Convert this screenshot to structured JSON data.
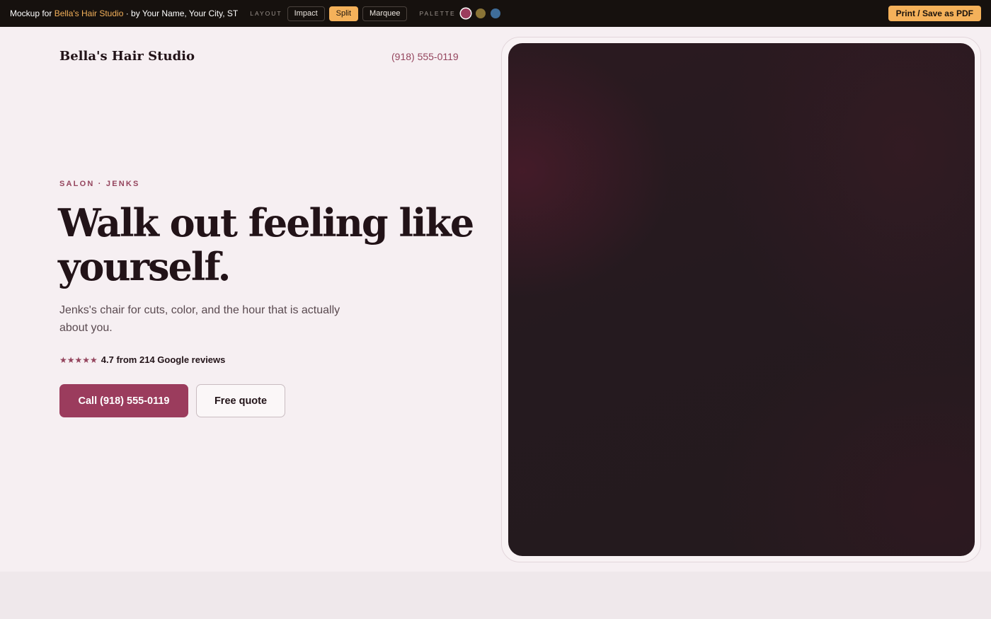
{
  "toolbar": {
    "mockup_prefix": "Mockup for ",
    "business_name": "Bella's Hair Studio",
    "mockup_suffix": " · by Your Name, Your City, ST",
    "layout_label": "LAYOUT",
    "layout_options": [
      "Impact",
      "Split",
      "Marquee"
    ],
    "layout_selected": "Split",
    "palette_label": "PALETTE",
    "palette_swatches": [
      "#9b3c5d",
      "#8a7436",
      "#3f6d99"
    ],
    "print_label": "Print / Save as PDF"
  },
  "site": {
    "name": "Bella's Hair Studio",
    "phone": "(918) 555-0119"
  },
  "hero": {
    "eyebrow": "SALON · JENKS",
    "headline": "Walk out feeling like yourself.",
    "subhead": "Jenks's chair for cuts, color, and the hour that is actually about you.",
    "stars": "★★★★★",
    "rating_text": "4.7 from 214 Google reviews",
    "primary_cta": "Call (918) 555-0119",
    "secondary_cta": "Free quote"
  },
  "colors": {
    "accent": "#9b3c5d",
    "toolbar_bg": "#16110e",
    "toolbar_highlight": "#f4b15a",
    "page_bg": "#f6eff2"
  }
}
